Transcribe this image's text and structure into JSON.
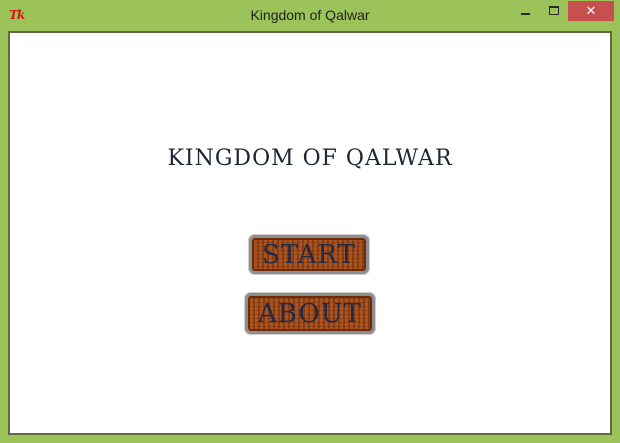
{
  "window": {
    "title": "Kingdom of Qalwar",
    "icon_text": "Tk",
    "icon": "tk-icon",
    "controls": {
      "minimize": "minimize-icon",
      "maximize": "maximize-icon",
      "close": "close-icon",
      "close_glyph": "✕"
    }
  },
  "game": {
    "title": "KINGDOM OF QALWAR",
    "start_label": "START",
    "about_label": "ABOUT"
  },
  "colors": {
    "frame": "#9cc35a",
    "close_button": "#c7504f",
    "button_wood": "#a8501c",
    "button_text": "#232843"
  }
}
